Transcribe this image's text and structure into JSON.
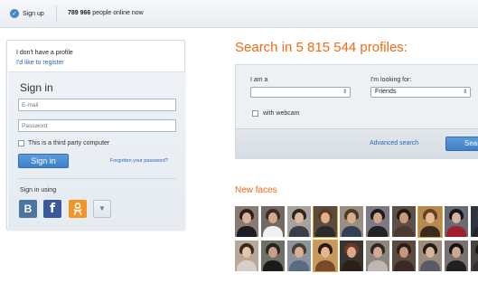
{
  "topbar": {
    "signup_label": "Sign up",
    "online_count": "789 966",
    "online_suffix": "people online now"
  },
  "signin_panel": {
    "no_profile_text": "I don't have a profile",
    "register_link": "I'd like to register",
    "title": "Sign in",
    "email_placeholder": "E-mail",
    "password_placeholder": "Password",
    "third_party_label": "This is a third party computer",
    "signin_button": "Sign in",
    "forgot_link": "Forgotten your password?",
    "signin_using_label": "Sign in using",
    "social": [
      {
        "name": "vkontakte",
        "glyph": "B",
        "color": "#4c75a3"
      },
      {
        "name": "facebook",
        "glyph": "f",
        "color": "#3b5998"
      },
      {
        "name": "odnoklassniki",
        "glyph": "ok-icon",
        "color": "#f29426"
      },
      {
        "name": "more",
        "glyph": "chevron-down-icon",
        "color": "#dfe6ed"
      }
    ]
  },
  "search": {
    "headline": "Search in 5 815 544 profiles:",
    "iam_label": "I am a",
    "iam_value": "",
    "looking_label": "I'm looking for:",
    "looking_value": "Friends",
    "webcam_label": "with webcam",
    "advanced_link": "Advanced search",
    "search_button": "Search"
  },
  "new_faces": {
    "title": "New faces",
    "thumbnails": [
      {
        "bg": "#8a7a70",
        "hair": "#2a2220",
        "skin": "#d9b49a",
        "shirt": "#1e1e22",
        "highlight": false
      },
      {
        "bg": "#6f6a66",
        "hair": "#3a2c24",
        "skin": "#d4a888",
        "shirt": "#f0f0f0",
        "highlight": false
      },
      {
        "bg": "#a7a29a",
        "hair": "#2b2622",
        "skin": "#dcb89e",
        "shirt": "#3a3e4a",
        "highlight": false
      },
      {
        "bg": "#5a4c3e",
        "hair": "#5a3a20",
        "skin": "#e0b08c",
        "shirt": "#2a2a2a",
        "highlight": true
      },
      {
        "bg": "#9a8e80",
        "hair": "#4a3a2a",
        "skin": "#d8ad8f",
        "shirt": "#333f55",
        "highlight": false
      },
      {
        "bg": "#7d7a86",
        "hair": "#1d1a1a",
        "skin": "#cfa48a",
        "shirt": "#222222",
        "highlight": false
      },
      {
        "bg": "#5e5046",
        "hair": "#241a14",
        "skin": "#c89a7a",
        "shirt": "#4a3a30",
        "highlight": false
      },
      {
        "bg": "#b48a52",
        "hair": "#6a4020",
        "skin": "#e4bc98",
        "shirt": "#3d2a1e",
        "highlight": true
      },
      {
        "bg": "#6a6a72",
        "hair": "#151515",
        "skin": "#d6b0a0",
        "shirt": "#a01f2a",
        "highlight": false
      },
      {
        "bg": "#2e3440",
        "hair": "#3a3a3a",
        "skin": "#cba58c",
        "shirt": "#20252e",
        "highlight": false
      },
      {
        "bg": "#b7a898",
        "hair": "#3a2a1e",
        "skin": "#e6c4a8",
        "shirt": "#d8d0c8",
        "highlight": false
      },
      {
        "bg": "#6e7264",
        "hair": "#252520",
        "skin": "#caa088",
        "shirt": "#1a1a1a",
        "highlight": false
      },
      {
        "bg": "#8b939c",
        "hair": "#4a3c30",
        "skin": "#d8b094",
        "shirt": "#5a6a80",
        "highlight": false
      },
      {
        "bg": "#c49a5e",
        "hair": "#2a1a10",
        "skin": "#e2b690",
        "shirt": "#7a4a2a",
        "highlight": true
      },
      {
        "bg": "#3a3430",
        "hair": "#6b3a22",
        "skin": "#e0a888",
        "shirt": "#2b1f1a",
        "highlight": false
      },
      {
        "bg": "#8c8680",
        "hair": "#322620",
        "skin": "#d2aa90",
        "shirt": "#c0b8b0",
        "highlight": false
      },
      {
        "bg": "#5c4a3e",
        "hair": "#2c1c14",
        "skin": "#c8967a",
        "shirt": "#3a2a22",
        "highlight": false
      },
      {
        "bg": "#9e8c7a",
        "hair": "#221a16",
        "skin": "#d8b49c",
        "shirt": "#5a5a66",
        "highlight": false
      },
      {
        "bg": "#7a7270",
        "hair": "#121212",
        "skin": "#d0a690",
        "shirt": "#202020",
        "highlight": false
      },
      {
        "bg": "#4a4440",
        "hair": "#1a1614",
        "skin": "#c49c84",
        "shirt": "#303030",
        "highlight": false
      }
    ]
  }
}
